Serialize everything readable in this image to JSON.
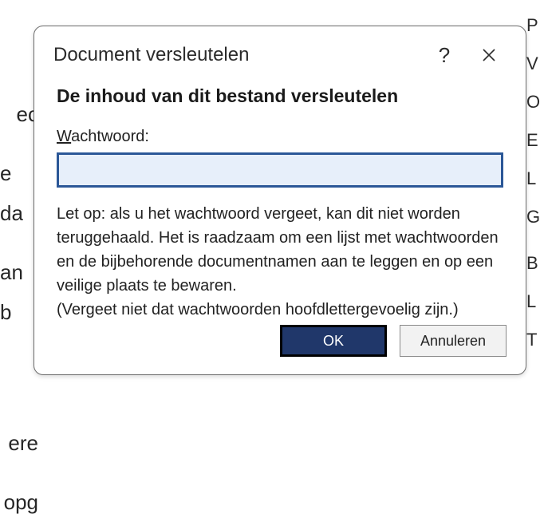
{
  "background": {
    "left_fragments": [
      "ec",
      "e da",
      "",
      "an b",
      "",
      "",
      "ere",
      "opg"
    ],
    "right_fragments": [
      "P",
      "V",
      "O",
      "",
      "E",
      "L",
      "",
      "G",
      "",
      "B",
      "",
      "L",
      "T"
    ]
  },
  "dialog": {
    "title": "Document versleutelen",
    "heading": "De inhoud van dit bestand versleutelen",
    "password_label_underline": "W",
    "password_label_rest": "achtwoord:",
    "password_value": "",
    "note_line1": "Let op: als u het wachtwoord vergeet, kan dit niet worden teruggehaald. Het is raadzaam om een lijst met wachtwoorden en de bijbehorende documentnamen aan te leggen en op een veilige plaats te bewaren.",
    "note_line2": "(Vergeet niet dat wachtwoorden hoofdlettergevoelig zijn.)",
    "ok_label": "OK",
    "cancel_label": "Annuleren",
    "help_glyph": "?"
  }
}
